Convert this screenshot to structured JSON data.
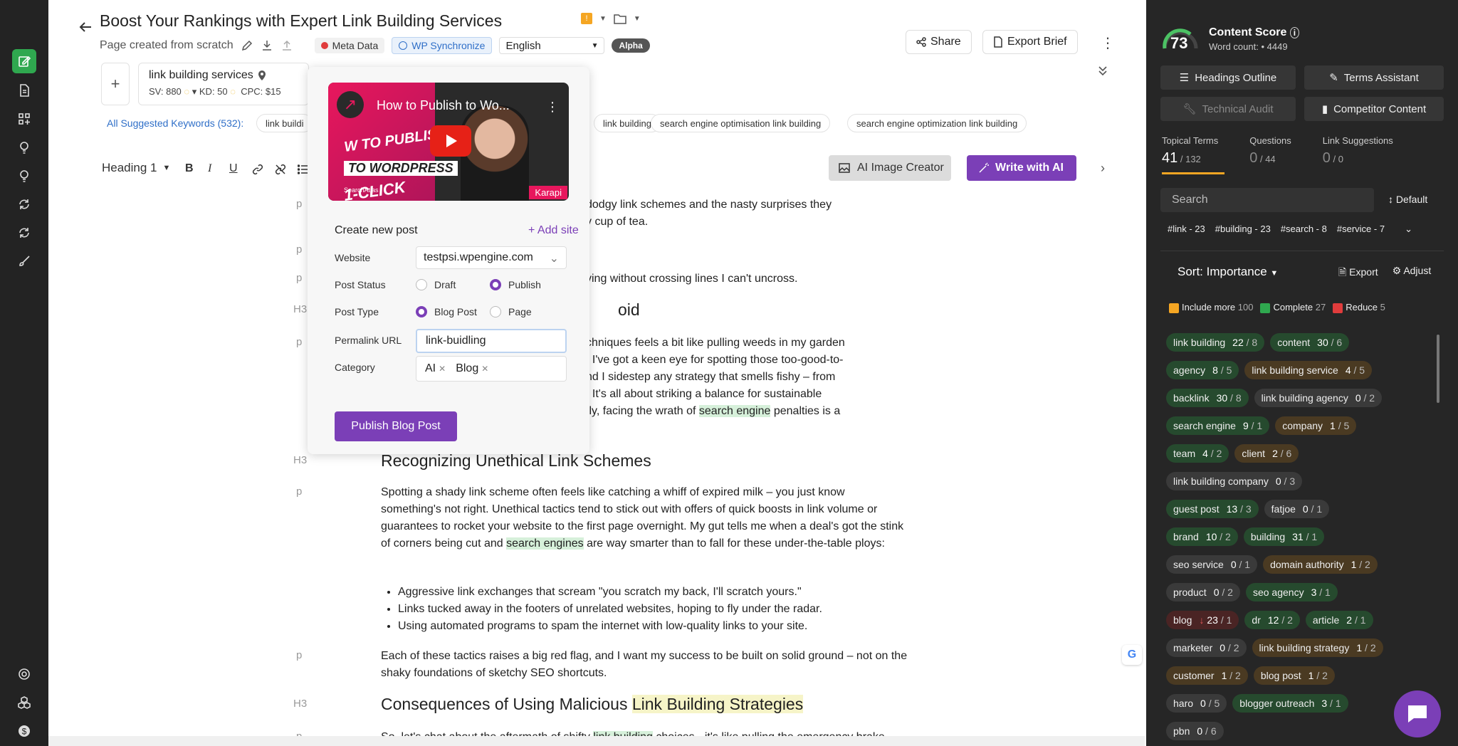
{
  "header": {
    "title": "Boost Your Rankings with Expert Link Building Services",
    "subtitle": "Page created from scratch",
    "meta_label": "Meta Data",
    "wp_label": "WP Synchronize",
    "language": "English",
    "alpha": "Alpha",
    "share_label": "Share",
    "export_label": "Export Brief",
    "warn_glyph": "!"
  },
  "keyword": {
    "name": "link building services",
    "sv": "SV: 880",
    "kd": "KD: 50",
    "cpc": "CPC: $15",
    "suggested_label": "All Suggested Keywords (532):",
    "chips": [
      "link buildi",
      "link building",
      "search engine optimisation link building",
      "search engine optimization link building"
    ]
  },
  "toolbar": {
    "heading": "Heading 1",
    "ai_image": "AI Image Creator",
    "write_ai": "Write with AI"
  },
  "editor": {
    "p1_line1": "dodgy link schemes and the nasty surprises they",
    "p1_line2": "y cup of tea.",
    "p2": "ving without crossing lines I can't uncross.",
    "h3_a_tail": "oid",
    "p3_l1": "chniques feels a bit like pulling weeds in my garden",
    "p3_l2": ". I've got a keen eye for spotting those too-good-to-",
    "p3_l3": "nd I sidestep any strategy that smells fishy – from",
    "p3_l4": ". It's all about striking a balance for sustainable",
    "p3_l5_a": "tly, facing the wrath of ",
    "p3_l5_hl": "search engine",
    "p3_l5_b": " penalties is a",
    "h3_b": "Recognizing Unethical Link Schemes",
    "p4_a": "Spotting a shady link scheme often feels like catching a whiff of expired milk – you just know something's not right. Unethical tactics tend to stick out with offers of quick boosts in link volume or guarantees to rocket your website to the first page overnight. My gut tells me when a deal's got the stink of corners being cut and ",
    "p4_hl": "search engines",
    "p4_b": " are way smarter than to fall for these under-the-table ploys:",
    "bullets": [
      "Aggressive link exchanges that scream \"you scratch my back, I'll scratch yours.\"",
      "Links tucked away in the footers of unrelated websites, hoping to fly under the radar.",
      "Using automated programs to spam the internet with low-quality links to your site."
    ],
    "p5": "Each of these tactics raises a big red flag, and I want my success to be built on solid ground – not on the shaky foundations of sketchy SEO shortcuts.",
    "h3_c_a": "Consequences of Using Malicious ",
    "h3_c_hl": "Link Building Strategies",
    "p6_a": "So, let's chat about the aftermath of shifty ",
    "p6_hl": "link building",
    "p6_b": " choices - it's like pulling the emergency brake",
    "tags": {
      "p": "p",
      "h3": "H3"
    }
  },
  "popup": {
    "video_title": "How to Publish to Wo...",
    "video_line1": "W TO PUBLISH",
    "video_line2": "TO WORDPRESS",
    "video_line3": "1-CLICK",
    "video_brand": "Karapi",
    "video_small_brand": "SearchAtlas",
    "heading": "Create new post",
    "add_site": "+ Add site",
    "website_label": "Website",
    "website_value": "testpsi.wpengine.com",
    "status_label": "Post Status",
    "status_draft": "Draft",
    "status_publish": "Publish",
    "type_label": "Post Type",
    "type_blog": "Blog Post",
    "type_page": "Page",
    "permalink_label": "Permalink URL",
    "permalink_value": "link-buidling",
    "category_label": "Category",
    "categories": [
      "AI",
      "Blog"
    ],
    "publish_btn": "Publish Blog Post"
  },
  "panel": {
    "score": "73",
    "score_label": "Content Score",
    "word_count": "Word count: • 4449",
    "headings_outline": "Headings Outline",
    "terms_assistant": "Terms Assistant",
    "technical_audit": "Technical Audit",
    "competitor_content": "Competitor Content",
    "tabs": [
      {
        "label": "Topical Terms",
        "value": "41",
        "total": " / 132"
      },
      {
        "label": "Questions",
        "value": "0",
        "total": " / 44"
      },
      {
        "label": "Link Suggestions",
        "value": "0",
        "total": " / 0"
      }
    ],
    "search_placeholder": "Search",
    "default_label": "Default",
    "hashtags": [
      "#link - 23",
      "#building - 23",
      "#search - 8",
      "#service - 7"
    ],
    "sort_label": "Sort: Importance",
    "export_label": "Export",
    "adjust_label": "Adjust",
    "filter_include": "Include more",
    "filter_include_n": "100",
    "filter_complete": "Complete",
    "filter_complete_n": "27",
    "filter_reduce": "Reduce",
    "filter_reduce_n": "5",
    "terms": [
      [
        {
          "t": "link building",
          "c": "22",
          "d": " / 8",
          "s": "green"
        },
        {
          "t": "content",
          "c": "30",
          "d": " / 6",
          "s": "green"
        }
      ],
      [
        {
          "t": "agency",
          "c": "8",
          "d": " / 5",
          "s": "green"
        },
        {
          "t": "link building service",
          "c": "4",
          "d": " / 5",
          "s": "brown"
        }
      ],
      [
        {
          "t": "backlink",
          "c": "30",
          "d": " / 8",
          "s": "green"
        },
        {
          "t": "link building agency",
          "c": "0",
          "d": " / 2",
          "s": ""
        }
      ],
      [
        {
          "t": "search engine",
          "c": "9",
          "d": " / 1",
          "s": "green"
        },
        {
          "t": "company",
          "c": "1",
          "d": " / 5",
          "s": "brown"
        }
      ],
      [
        {
          "t": "team",
          "c": "4",
          "d": " / 2",
          "s": "green"
        },
        {
          "t": "client",
          "c": "2",
          "d": " / 6",
          "s": "brown"
        }
      ],
      [
        {
          "t": "link building company",
          "c": "0",
          "d": " / 3",
          "s": ""
        }
      ],
      [
        {
          "t": "guest post",
          "c": "13",
          "d": " / 3",
          "s": "green"
        },
        {
          "t": "fatjoe",
          "c": "0",
          "d": " / 1",
          "s": ""
        }
      ],
      [
        {
          "t": "brand",
          "c": "10",
          "d": " / 2",
          "s": "green"
        },
        {
          "t": "building",
          "c": "31",
          "d": " / 1",
          "s": "green"
        }
      ],
      [
        {
          "t": "seo service",
          "c": "0",
          "d": " / 1",
          "s": ""
        },
        {
          "t": "domain authority",
          "c": "1",
          "d": " / 2",
          "s": "brown"
        }
      ],
      [
        {
          "t": "product",
          "c": "0",
          "d": " / 2",
          "s": ""
        },
        {
          "t": "seo agency",
          "c": "3",
          "d": " / 1",
          "s": "green"
        }
      ],
      [
        {
          "t": "blog",
          "c": "23",
          "d": " / 1",
          "s": "red",
          "down": true
        },
        {
          "t": "dr",
          "c": "12",
          "d": " / 2",
          "s": "green"
        },
        {
          "t": "article",
          "c": "2",
          "d": " / 1",
          "s": "green"
        }
      ],
      [
        {
          "t": "marketer",
          "c": "0",
          "d": " / 2",
          "s": ""
        },
        {
          "t": "link building strategy",
          "c": "1",
          "d": " / 2",
          "s": "brown"
        }
      ],
      [
        {
          "t": "customer",
          "c": "1",
          "d": " / 2",
          "s": "brown"
        },
        {
          "t": "blog post",
          "c": "1",
          "d": " / 2",
          "s": "brown"
        }
      ],
      [
        {
          "t": "haro",
          "c": "0",
          "d": " / 5",
          "s": ""
        },
        {
          "t": "blogger outreach",
          "c": "3",
          "d": " / 1",
          "s": "green"
        }
      ],
      [
        {
          "t": "pbn",
          "c": "0",
          "d": " / 6",
          "s": ""
        }
      ]
    ]
  }
}
